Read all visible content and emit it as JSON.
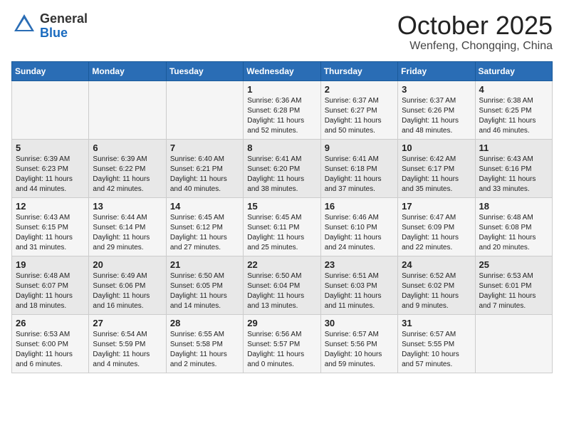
{
  "header": {
    "logo_line1": "General",
    "logo_line2": "Blue",
    "month_title": "October 2025",
    "location": "Wenfeng, Chongqing, China"
  },
  "weekdays": [
    "Sunday",
    "Monday",
    "Tuesday",
    "Wednesday",
    "Thursday",
    "Friday",
    "Saturday"
  ],
  "weeks": [
    [
      {
        "day": "",
        "info": ""
      },
      {
        "day": "",
        "info": ""
      },
      {
        "day": "",
        "info": ""
      },
      {
        "day": "1",
        "info": "Sunrise: 6:36 AM\nSunset: 6:28 PM\nDaylight: 11 hours\nand 52 minutes."
      },
      {
        "day": "2",
        "info": "Sunrise: 6:37 AM\nSunset: 6:27 PM\nDaylight: 11 hours\nand 50 minutes."
      },
      {
        "day": "3",
        "info": "Sunrise: 6:37 AM\nSunset: 6:26 PM\nDaylight: 11 hours\nand 48 minutes."
      },
      {
        "day": "4",
        "info": "Sunrise: 6:38 AM\nSunset: 6:25 PM\nDaylight: 11 hours\nand 46 minutes."
      }
    ],
    [
      {
        "day": "5",
        "info": "Sunrise: 6:39 AM\nSunset: 6:23 PM\nDaylight: 11 hours\nand 44 minutes."
      },
      {
        "day": "6",
        "info": "Sunrise: 6:39 AM\nSunset: 6:22 PM\nDaylight: 11 hours\nand 42 minutes."
      },
      {
        "day": "7",
        "info": "Sunrise: 6:40 AM\nSunset: 6:21 PM\nDaylight: 11 hours\nand 40 minutes."
      },
      {
        "day": "8",
        "info": "Sunrise: 6:41 AM\nSunset: 6:20 PM\nDaylight: 11 hours\nand 38 minutes."
      },
      {
        "day": "9",
        "info": "Sunrise: 6:41 AM\nSunset: 6:18 PM\nDaylight: 11 hours\nand 37 minutes."
      },
      {
        "day": "10",
        "info": "Sunrise: 6:42 AM\nSunset: 6:17 PM\nDaylight: 11 hours\nand 35 minutes."
      },
      {
        "day": "11",
        "info": "Sunrise: 6:43 AM\nSunset: 6:16 PM\nDaylight: 11 hours\nand 33 minutes."
      }
    ],
    [
      {
        "day": "12",
        "info": "Sunrise: 6:43 AM\nSunset: 6:15 PM\nDaylight: 11 hours\nand 31 minutes."
      },
      {
        "day": "13",
        "info": "Sunrise: 6:44 AM\nSunset: 6:14 PM\nDaylight: 11 hours\nand 29 minutes."
      },
      {
        "day": "14",
        "info": "Sunrise: 6:45 AM\nSunset: 6:12 PM\nDaylight: 11 hours\nand 27 minutes."
      },
      {
        "day": "15",
        "info": "Sunrise: 6:45 AM\nSunset: 6:11 PM\nDaylight: 11 hours\nand 25 minutes."
      },
      {
        "day": "16",
        "info": "Sunrise: 6:46 AM\nSunset: 6:10 PM\nDaylight: 11 hours\nand 24 minutes."
      },
      {
        "day": "17",
        "info": "Sunrise: 6:47 AM\nSunset: 6:09 PM\nDaylight: 11 hours\nand 22 minutes."
      },
      {
        "day": "18",
        "info": "Sunrise: 6:48 AM\nSunset: 6:08 PM\nDaylight: 11 hours\nand 20 minutes."
      }
    ],
    [
      {
        "day": "19",
        "info": "Sunrise: 6:48 AM\nSunset: 6:07 PM\nDaylight: 11 hours\nand 18 minutes."
      },
      {
        "day": "20",
        "info": "Sunrise: 6:49 AM\nSunset: 6:06 PM\nDaylight: 11 hours\nand 16 minutes."
      },
      {
        "day": "21",
        "info": "Sunrise: 6:50 AM\nSunset: 6:05 PM\nDaylight: 11 hours\nand 14 minutes."
      },
      {
        "day": "22",
        "info": "Sunrise: 6:50 AM\nSunset: 6:04 PM\nDaylight: 11 hours\nand 13 minutes."
      },
      {
        "day": "23",
        "info": "Sunrise: 6:51 AM\nSunset: 6:03 PM\nDaylight: 11 hours\nand 11 minutes."
      },
      {
        "day": "24",
        "info": "Sunrise: 6:52 AM\nSunset: 6:02 PM\nDaylight: 11 hours\nand 9 minutes."
      },
      {
        "day": "25",
        "info": "Sunrise: 6:53 AM\nSunset: 6:01 PM\nDaylight: 11 hours\nand 7 minutes."
      }
    ],
    [
      {
        "day": "26",
        "info": "Sunrise: 6:53 AM\nSunset: 6:00 PM\nDaylight: 11 hours\nand 6 minutes."
      },
      {
        "day": "27",
        "info": "Sunrise: 6:54 AM\nSunset: 5:59 PM\nDaylight: 11 hours\nand 4 minutes."
      },
      {
        "day": "28",
        "info": "Sunrise: 6:55 AM\nSunset: 5:58 PM\nDaylight: 11 hours\nand 2 minutes."
      },
      {
        "day": "29",
        "info": "Sunrise: 6:56 AM\nSunset: 5:57 PM\nDaylight: 11 hours\nand 0 minutes."
      },
      {
        "day": "30",
        "info": "Sunrise: 6:57 AM\nSunset: 5:56 PM\nDaylight: 10 hours\nand 59 minutes."
      },
      {
        "day": "31",
        "info": "Sunrise: 6:57 AM\nSunset: 5:55 PM\nDaylight: 10 hours\nand 57 minutes."
      },
      {
        "day": "",
        "info": ""
      }
    ]
  ]
}
